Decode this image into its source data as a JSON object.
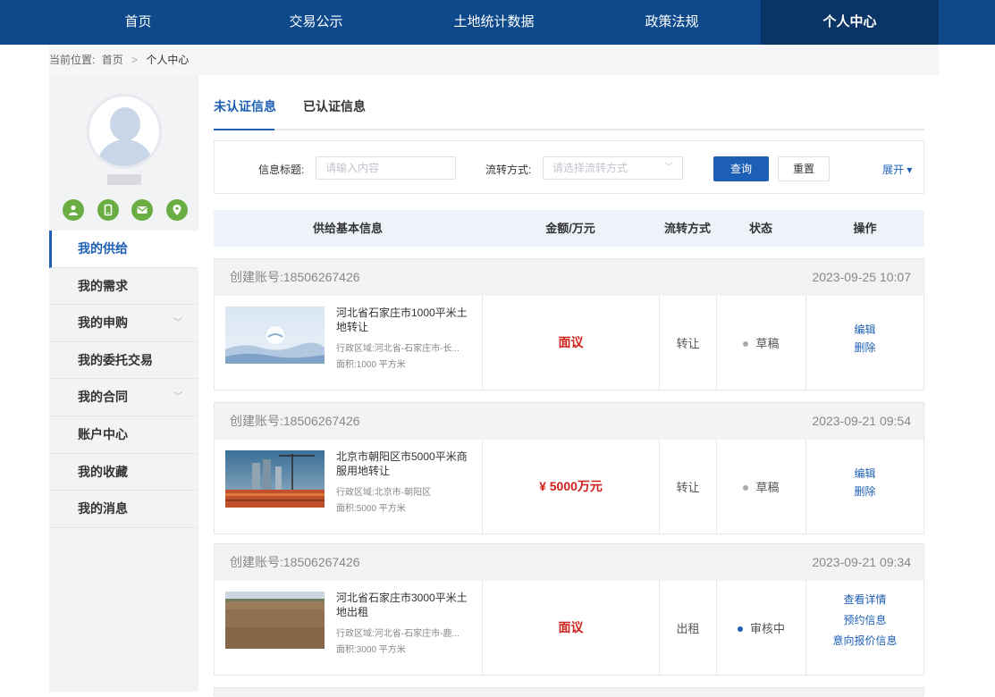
{
  "nav": {
    "items": [
      {
        "label": "首页",
        "active": false
      },
      {
        "label": "交易公示",
        "active": false
      },
      {
        "label": "土地统计数据",
        "active": false
      },
      {
        "label": "政策法规",
        "active": false
      },
      {
        "label": "个人中心",
        "active": true
      }
    ]
  },
  "breadcrumb": {
    "prefix": "当前位置:",
    "home": "首页",
    "separator": ">",
    "current": "个人中心"
  },
  "sidebar": {
    "verify_icons": [
      "person-verify-icon",
      "phone-verify-icon",
      "email-verify-icon",
      "location-verify-icon"
    ],
    "verify_color": "#6aae43",
    "menu": [
      {
        "label": "我的供给",
        "active": true,
        "has_chevron": false
      },
      {
        "label": "我的需求",
        "active": false,
        "has_chevron": false
      },
      {
        "label": "我的申购",
        "active": false,
        "has_chevron": true
      },
      {
        "label": "我的委托交易",
        "active": false,
        "has_chevron": false
      },
      {
        "label": "我的合同",
        "active": false,
        "has_chevron": true
      },
      {
        "label": "账户中心",
        "active": false,
        "has_chevron": false
      },
      {
        "label": "我的收藏",
        "active": false,
        "has_chevron": false
      },
      {
        "label": "我的消息",
        "active": false,
        "has_chevron": false
      }
    ]
  },
  "tabs": {
    "unverified": "未认证信息",
    "verified": "已认证信息",
    "active": "unverified"
  },
  "filter": {
    "title_label": "信息标题:",
    "title_placeholder": "请输入内容",
    "mode_label": "流转方式:",
    "mode_placeholder": "请选择流转方式",
    "query_button": "查询",
    "reset_button": "重置",
    "expand_label": "展开 ▾"
  },
  "table": {
    "headers": {
      "info": "供给基本信息",
      "amount": "金额/万元",
      "mode": "流转方式",
      "status": "状态",
      "action": "操作"
    },
    "rows": [
      {
        "account": "创建账号:18506267426",
        "time": "2023-09-25 10:07",
        "title": "河北省石家庄市1000平米土地转让",
        "region": "行政区域:河北省-石家庄市-长...",
        "area": "面积:1000 平方米",
        "price": "面议",
        "mode": "转让",
        "status": "草稿",
        "status_color": "#aaaaaa",
        "thumb": "sky-fog",
        "actions": [
          "编辑",
          "删除"
        ]
      },
      {
        "account": "创建账号:18506267426",
        "time": "2023-09-21 09:54",
        "title": "北京市朝阳区市5000平米商服用地转让",
        "region": "行政区域:北京市-朝阳区",
        "area": "面积:5000 平方米",
        "price": "¥ 5000万元",
        "mode": "转让",
        "status": "草稿",
        "status_color": "#aaaaaa",
        "thumb": "construction-site",
        "actions": [
          "编辑",
          "删除"
        ]
      },
      {
        "account": "创建账号:18506267426",
        "time": "2023-09-21 09:34",
        "title": "河北省石家庄市3000平米土地出租",
        "region": "行政区域:河北省-石家庄市-鹿...",
        "area": "面积:3000 平方米",
        "price": "面议",
        "mode": "出租",
        "status": "审核中",
        "status_color": "#1d5fb4",
        "thumb": "bare-field",
        "actions": [
          "查看详情",
          "预约信息",
          "意向报价信息"
        ]
      }
    ]
  },
  "colors": {
    "nav_bg": "#0e4a8b",
    "nav_active_bg": "#0a3366",
    "accent": "#1d5fb4",
    "price_red": "#d0201b"
  }
}
